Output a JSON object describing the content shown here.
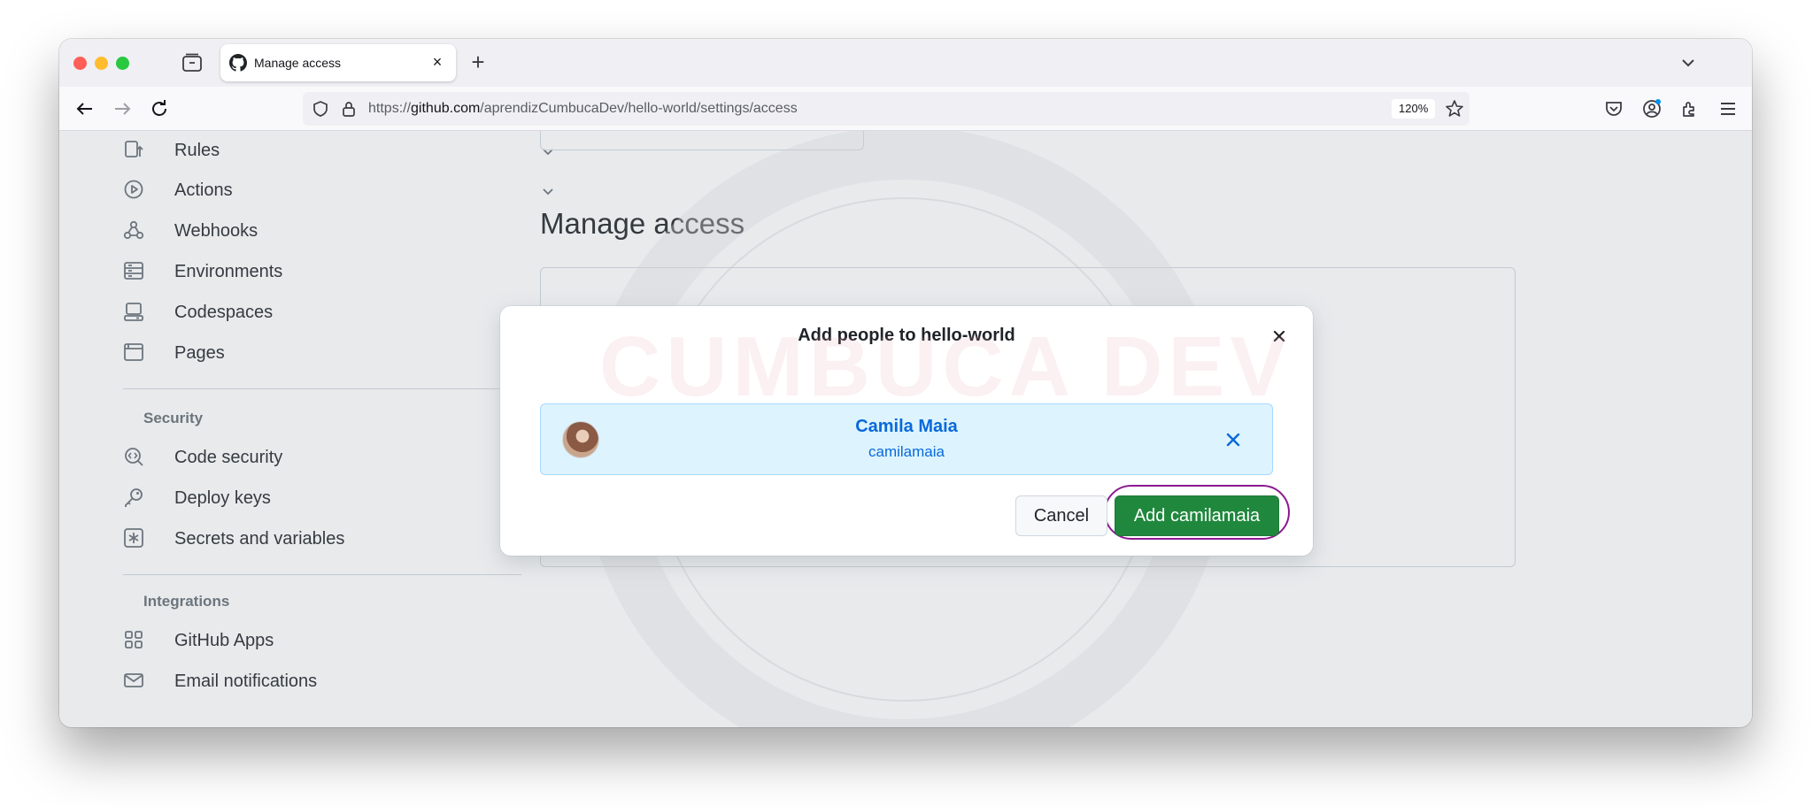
{
  "browser": {
    "tab_title": "Manage access",
    "tab_close": "×",
    "new_tab": "+",
    "url_prefix": "https://",
    "url_domain": "github.com",
    "url_path": "/aprendizCumbucaDev/hello-world/settings/access",
    "zoom": "120%"
  },
  "sidebar": {
    "items_top": [
      {
        "label": "Rules",
        "icon": "rules-icon",
        "expandable": true
      },
      {
        "label": "Actions",
        "icon": "play-icon",
        "expandable": true
      },
      {
        "label": "Webhooks",
        "icon": "webhook-icon",
        "expandable": false
      },
      {
        "label": "Environments",
        "icon": "server-icon",
        "expandable": false
      },
      {
        "label": "Codespaces",
        "icon": "codespaces-icon",
        "expandable": false
      },
      {
        "label": "Pages",
        "icon": "browser-icon",
        "expandable": false
      }
    ],
    "security_heading": "Security",
    "security_items": [
      {
        "label": "Code security",
        "icon": "codescan-icon",
        "expandable": false
      },
      {
        "label": "Deploy keys",
        "icon": "key-icon",
        "expandable": false
      },
      {
        "label": "Secrets and variables",
        "icon": "asterisk-icon",
        "expandable": true
      }
    ],
    "integrations_heading": "Integrations",
    "integrations_items": [
      {
        "label": "GitHub Apps",
        "icon": "apps-icon",
        "expandable": false
      },
      {
        "label": "Email notifications",
        "icon": "mail-icon",
        "expandable": false
      }
    ]
  },
  "main": {
    "title": "Manage access"
  },
  "watermark": {
    "text": "CUMBUCA DEV"
  },
  "dialog": {
    "title": "Add people to hello-world",
    "user": {
      "name": "Camila Maia",
      "login": "camilamaia"
    },
    "cancel_label": "Cancel",
    "add_label": "Add camilamaia"
  },
  "colors": {
    "primary_button": "#1f883d",
    "link": "#0969da",
    "user_card_bg": "#ddf4ff",
    "highlight_ring": "#8a1a8f"
  }
}
